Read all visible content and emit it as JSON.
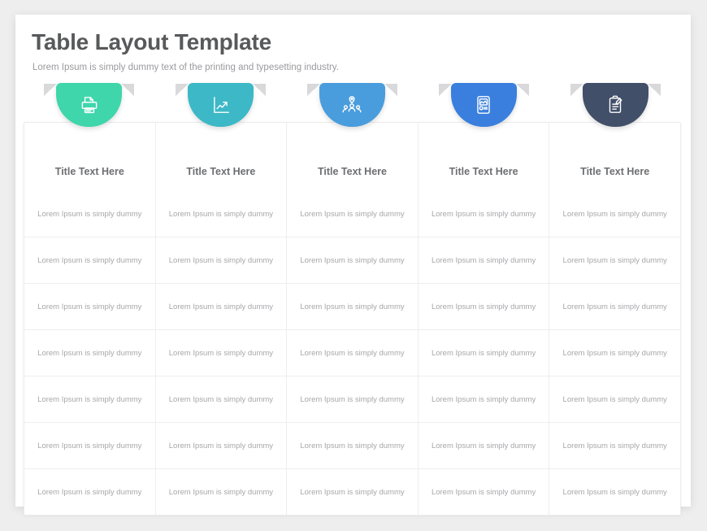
{
  "slide": {
    "title": "Table Layout Template",
    "subtitle": "Lorem Ipsum is simply dummy text of the printing and typesetting industry."
  },
  "columns": [
    {
      "icon": "printer-icon",
      "color": "#3fd6ac",
      "header": "Title Text Here"
    },
    {
      "icon": "line-chart-growth-icon",
      "color": "#3db8c6",
      "header": "Title Text Here"
    },
    {
      "icon": "team-location-icon",
      "color": "#4a9ddc",
      "header": "Title Text Here"
    },
    {
      "icon": "mobile-media-icon",
      "color": "#3a7fdd",
      "header": "Title Text Here"
    },
    {
      "icon": "clipboard-pen-icon",
      "color": "#424f68",
      "header": "Title Text Here"
    }
  ],
  "ribbon_tail_color": "#d9d9db",
  "table": {
    "headers": [
      "Title Text Here",
      "Title Text Here",
      "Title Text Here",
      "Title Text Here",
      "Title Text Here"
    ],
    "rows": [
      [
        "Lorem Ipsum is simply dummy",
        "Lorem Ipsum is simply dummy",
        "Lorem Ipsum is simply dummy",
        "Lorem Ipsum is simply dummy",
        "Lorem Ipsum is simply dummy"
      ],
      [
        "Lorem Ipsum is simply dummy",
        "Lorem Ipsum is simply dummy",
        "Lorem Ipsum is simply dummy",
        "Lorem Ipsum is simply dummy",
        "Lorem Ipsum is simply dummy"
      ],
      [
        "Lorem Ipsum is simply dummy",
        "Lorem Ipsum is simply dummy",
        "Lorem Ipsum is simply dummy",
        "Lorem Ipsum is simply dummy",
        "Lorem Ipsum is simply dummy"
      ],
      [
        "Lorem Ipsum is simply dummy",
        "Lorem Ipsum is simply dummy",
        "Lorem Ipsum is simply dummy",
        "Lorem Ipsum is simply dummy",
        "Lorem Ipsum is simply dummy"
      ],
      [
        "Lorem Ipsum is simply dummy",
        "Lorem Ipsum is simply dummy",
        "Lorem Ipsum is simply dummy",
        "Lorem Ipsum is simply dummy",
        "Lorem Ipsum is simply dummy"
      ],
      [
        "Lorem Ipsum is simply dummy",
        "Lorem Ipsum is simply dummy",
        "Lorem Ipsum is simply dummy",
        "Lorem Ipsum is simply dummy",
        "Lorem Ipsum is simply dummy"
      ],
      [
        "Lorem Ipsum is simply dummy",
        "Lorem Ipsum is simply dummy",
        "Lorem Ipsum is simply dummy",
        "Lorem Ipsum is simply dummy",
        "Lorem Ipsum is simply dummy"
      ]
    ]
  }
}
